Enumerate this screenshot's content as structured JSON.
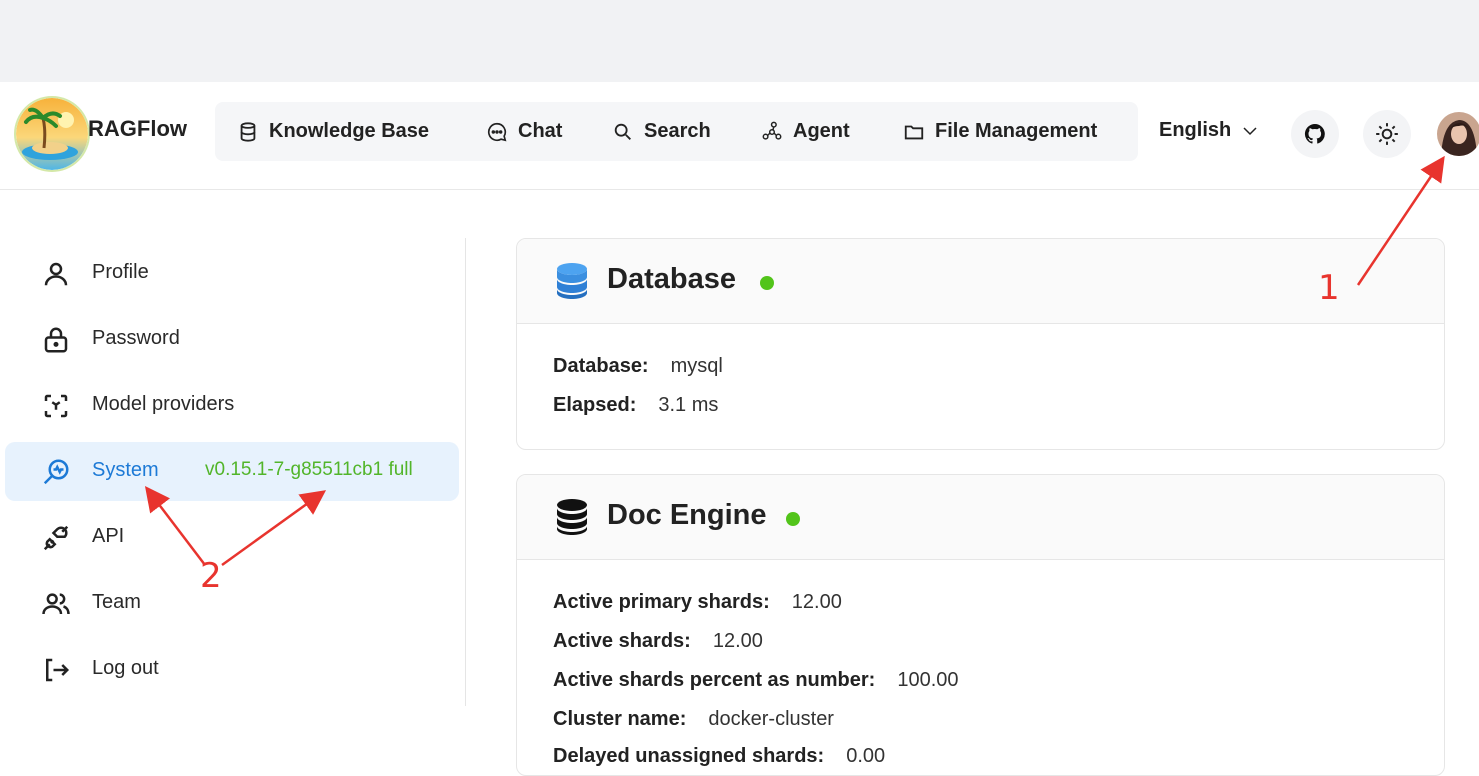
{
  "app": {
    "brand": "RAGFlow"
  },
  "nav": {
    "items": [
      {
        "label": "Knowledge Base",
        "icon": "database-icon"
      },
      {
        "label": "Chat",
        "icon": "chat-bubble-icon"
      },
      {
        "label": "Search",
        "icon": "search-icon"
      },
      {
        "label": "Agent",
        "icon": "agent-graph-icon"
      },
      {
        "label": "File Management",
        "icon": "folder-icon"
      }
    ],
    "language": "English"
  },
  "sidebar": {
    "items": [
      {
        "label": "Profile",
        "icon": "user-icon"
      },
      {
        "label": "Password",
        "icon": "lock-icon"
      },
      {
        "label": "Model providers",
        "icon": "model-box-icon"
      },
      {
        "label": "System",
        "icon": "system-monitor-icon",
        "active": true,
        "version": "v0.15.1-7-g85511cb1 full"
      },
      {
        "label": "API",
        "icon": "plug-icon"
      },
      {
        "label": "Team",
        "icon": "team-icon"
      },
      {
        "label": "Log out",
        "icon": "logout-icon"
      }
    ]
  },
  "database": {
    "title": "Database",
    "status_color": "#52c41a",
    "rows": [
      {
        "label": "Database:",
        "value": "mysql"
      },
      {
        "label": "Elapsed:",
        "value": "3.1 ms"
      }
    ]
  },
  "doc_engine": {
    "title": "Doc Engine",
    "status_color": "#52c41a",
    "rows": [
      {
        "label": "Active primary shards:",
        "value": "12.00"
      },
      {
        "label": "Active shards:",
        "value": "12.00"
      },
      {
        "label": "Active shards percent as number:",
        "value": "100.00"
      },
      {
        "label": "Cluster name:",
        "value": "docker-cluster"
      },
      {
        "label": "Delayed unassigned shards:",
        "value": "0.00"
      }
    ]
  },
  "annotations": {
    "one": "1",
    "two": "2"
  }
}
